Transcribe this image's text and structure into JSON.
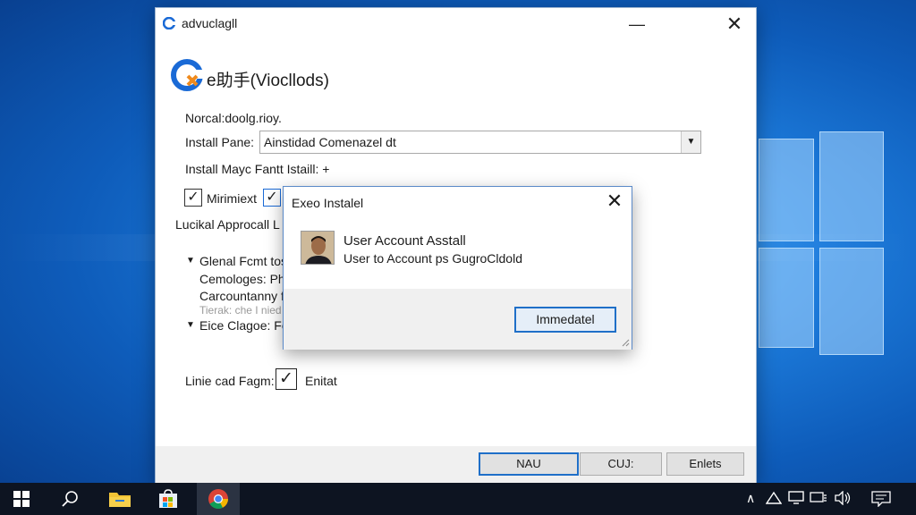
{
  "window": {
    "title": "advuclagll",
    "min_glyph": "—",
    "close_glyph": "✕"
  },
  "header": {
    "title": "e助手(Viocllods)"
  },
  "form": {
    "description": "Norcal:doolg.rioy.",
    "install_path_label": "Install Pane:",
    "install_path_value": "Ainstidad Comenazel dt",
    "install_mode_label": "Install Mayc Fantt Istaill:  +",
    "checkbox1_label": "Mirimiext",
    "checkbox1_checked": true,
    "checkbox2_checked": true,
    "section_label": "Lucikal Approcall L",
    "tree": [
      {
        "label": "Glenal Fcmt tos",
        "arrow": true
      },
      {
        "label": "Cemologes: Pha",
        "arrow": false
      },
      {
        "label": "Carcountanny fo",
        "arrow": false
      },
      {
        "label": "Tierak: che I nied",
        "arrow": false,
        "faded": true
      },
      {
        "label": "Eice Clagoe: Foe",
        "arrow": true
      }
    ],
    "line_label": "Linie cad Fagm: -",
    "line_checkbox_checked": true,
    "line_checkbox_label": "Enitat"
  },
  "footer": {
    "buttons": [
      "NAU",
      "CUJ:",
      "Enlets"
    ]
  },
  "dialog": {
    "title": "Exeo Instalel",
    "close_glyph": "✕",
    "line1": "User Account Asstall",
    "line2": "User to Account ps GugroCldold",
    "button": "Immedatel"
  },
  "colors": {
    "accent": "#1f6fc8",
    "wallpaper": "#1e7ede",
    "taskbar": "#0d1421"
  },
  "taskbar": {
    "items": [
      "windows-start-icon",
      "search-icon",
      "file-explorer-icon",
      "store-icon",
      "chrome-icon"
    ],
    "tray": [
      "chevron-up-icon",
      "network-icon",
      "display-icon",
      "wifi-icon",
      "volume-icon",
      "notification-icon"
    ]
  }
}
